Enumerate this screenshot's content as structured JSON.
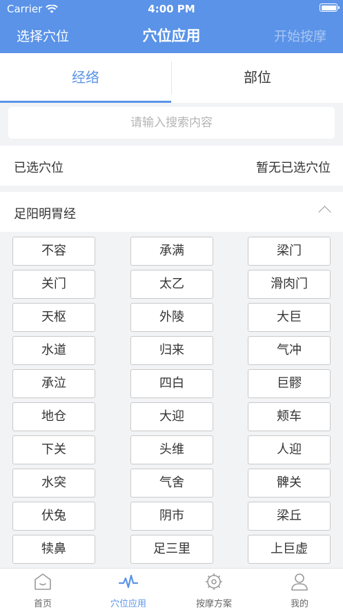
{
  "status": {
    "carrier": "Carrier",
    "time": "4:00 PM"
  },
  "nav": {
    "left": "选择穴位",
    "title": "穴位应用",
    "right": "开始按摩"
  },
  "tabs": [
    {
      "label": "经络"
    },
    {
      "label": "部位"
    }
  ],
  "search": {
    "placeholder": "请输入搜索内容"
  },
  "selected": {
    "label": "已选穴位",
    "value": "暂无已选穴位"
  },
  "section": {
    "title": "足阳明胃经"
  },
  "points": [
    "不容",
    "承满",
    "梁门",
    "关门",
    "太乙",
    "滑肉门",
    "天枢",
    "外陵",
    "大巨",
    "水道",
    "归来",
    "气冲",
    "承泣",
    "四白",
    "巨髎",
    "地仓",
    "大迎",
    "颊车",
    "下关",
    "头维",
    "人迎",
    "水突",
    "气舍",
    "髀关",
    "伏兔",
    "阴市",
    "梁丘",
    "犊鼻",
    "足三里",
    "上巨虚"
  ],
  "tabbar": [
    {
      "label": "首页",
      "icon": "home-icon"
    },
    {
      "label": "穴位应用",
      "icon": "pulse-icon"
    },
    {
      "label": "按摩方案",
      "icon": "massage-gear-icon"
    },
    {
      "label": "我的",
      "icon": "user-icon"
    }
  ],
  "colors": {
    "primary": "#5a93e8",
    "background": "#f2f3f5"
  }
}
